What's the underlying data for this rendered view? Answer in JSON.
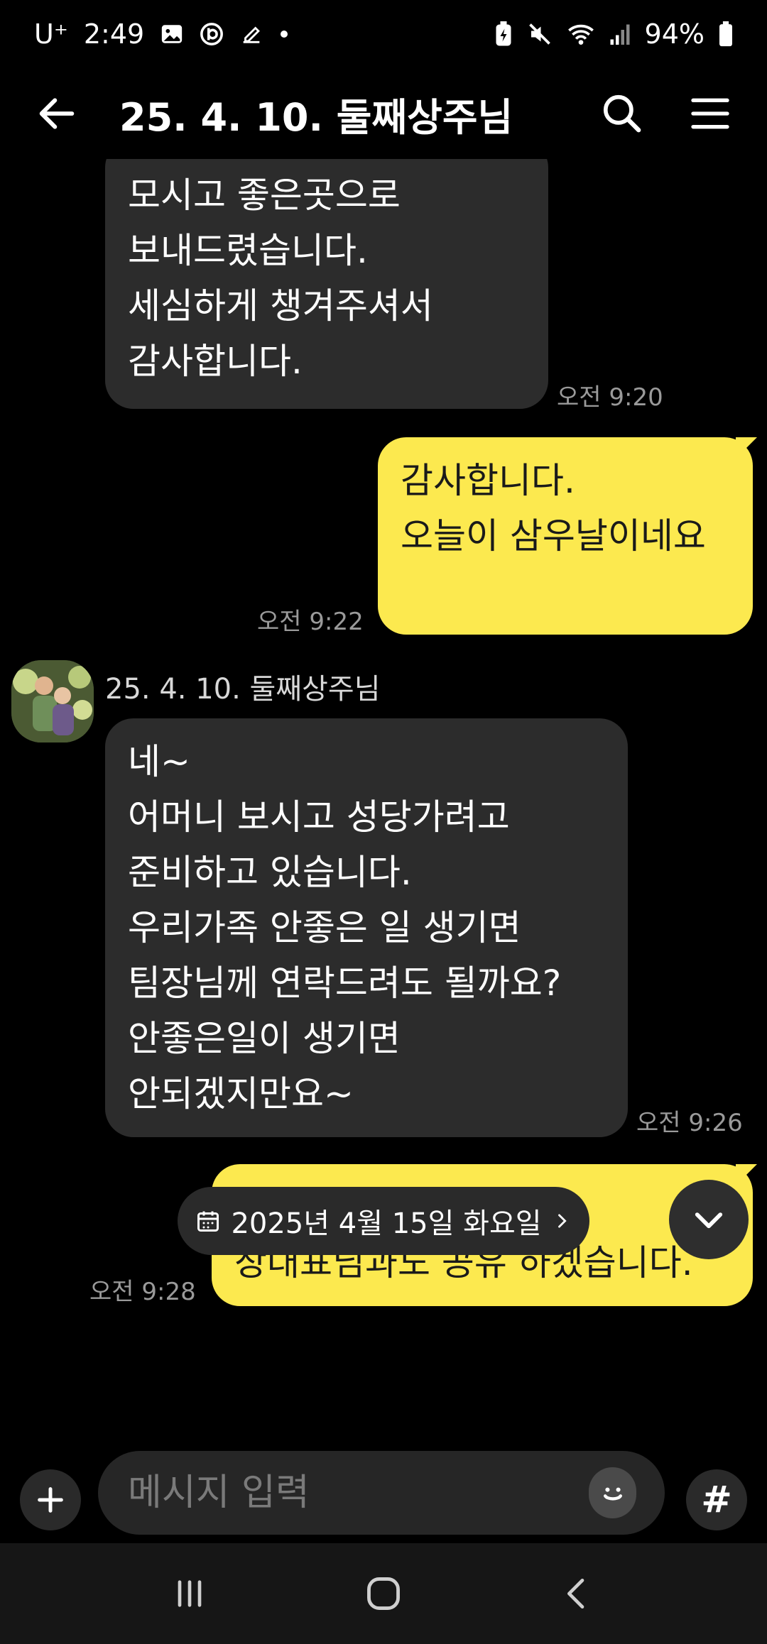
{
  "status_bar": {
    "carrier": "U⁺",
    "time": "2:49",
    "battery": "94%"
  },
  "header": {
    "title": "25. 4. 10. 둘째상주님"
  },
  "messages": [
    {
      "direction": "in",
      "text": "모시고 좋은곳으로\n보내드렸습니다.\n세심하게 챙겨주셔서\n감사합니다.",
      "time": "오전 9:20"
    },
    {
      "direction": "out",
      "text": "감사합니다.\n오늘이 삼우날이네요",
      "time": "오전 9:22"
    },
    {
      "direction": "in",
      "sender": "25. 4. 10. 둘째상주님",
      "text": "네~\n어머니 보시고 성당가려고\n준비하고 있습니다.\n우리가족 안좋은 일 생기면\n팀장님께 연락드려도 될까요?\n안좋은일이 생기면\n안되겠지만요~",
      "time": "오전 9:26"
    },
    {
      "direction": "out",
      "text": "네 먼훗날 연락 주세요\n장대표님과도 공유 하겠습니다.",
      "time": "오전 9:28"
    }
  ],
  "date_chip": {
    "label": "2025년 4월 15일 화요일"
  },
  "input": {
    "placeholder": "메시지 입력",
    "hash": "#"
  },
  "colors": {
    "background": "#000000",
    "incoming_bubble": "#2c2c2c",
    "outgoing_bubble": "#fce94f"
  },
  "icons": {
    "back": "arrow-left-icon",
    "search": "search-icon",
    "menu": "hamburger-menu-icon",
    "calendar": "calendar-icon",
    "scroll_down": "chevron-down-icon",
    "plus": "plus-icon",
    "emoji": "emoji-icon"
  }
}
